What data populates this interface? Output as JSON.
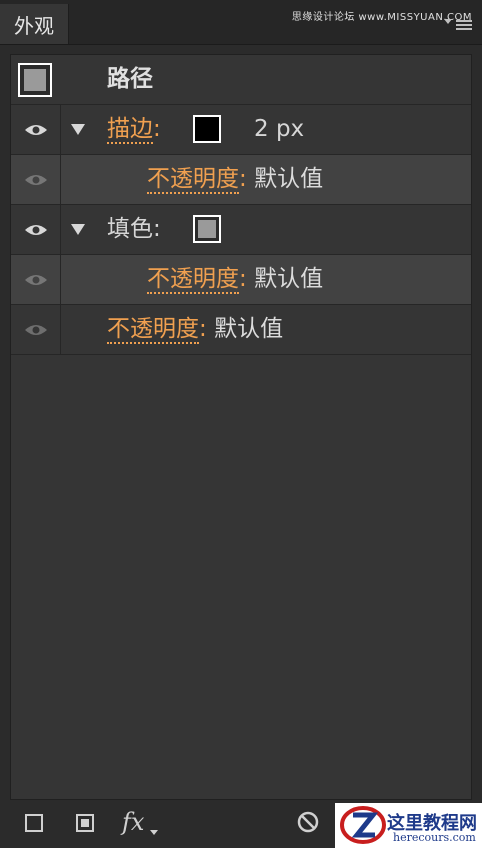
{
  "tab": {
    "title": "外观"
  },
  "watermark": "思缘设计论坛 www.MISSYUAN.COM",
  "header": {
    "title": "路径"
  },
  "rows": {
    "stroke": {
      "label": "描边",
      "colon": ":",
      "value": "2 px"
    },
    "stroke_opacity": {
      "label": "不透明度",
      "colon": ":",
      "value": "默认值"
    },
    "fill": {
      "label": "填色",
      "colon": ":"
    },
    "fill_opacity": {
      "label": "不透明度",
      "colon": ":",
      "value": "默认值"
    },
    "opacity": {
      "label": "不透明度",
      "colon": ":",
      "value": "默认值"
    }
  },
  "toolbar": {
    "fx": "fx"
  },
  "logo": {
    "title": "这里教程网",
    "url": "herecours.com"
  },
  "colors": {
    "accent": "#f0a050",
    "panel": "#353535",
    "stroke_swatch": "#000000",
    "fill_swatch": "#9a9a9a"
  },
  "icons": [
    "eye-icon",
    "disclosure-triangle-icon",
    "panel-menu-icon",
    "new-stroke-icon",
    "new-fill-icon",
    "fx-icon",
    "clear-appearance-icon"
  ]
}
